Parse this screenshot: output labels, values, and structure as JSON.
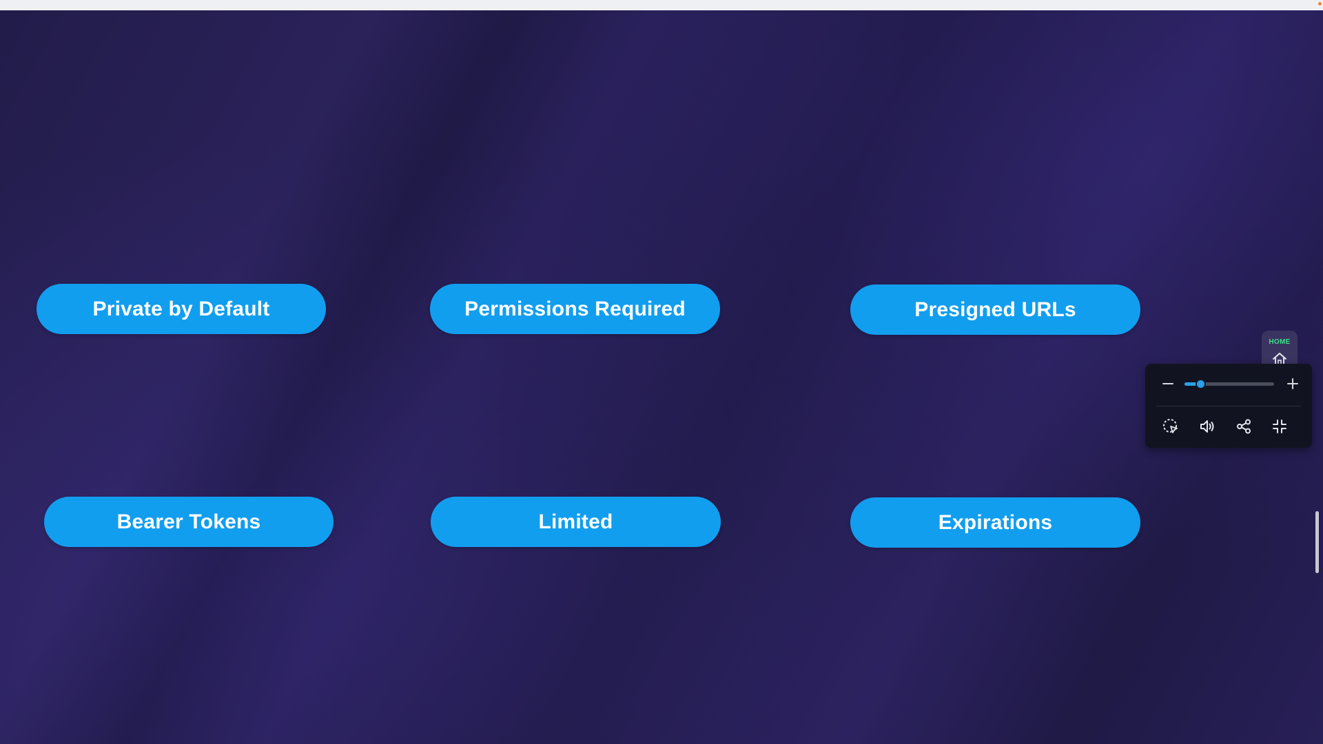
{
  "cards": [
    {
      "label": "Private by Default"
    },
    {
      "label": "Permissions Required"
    },
    {
      "label": "Presigned URLs"
    },
    {
      "label": "Bearer Tokens"
    },
    {
      "label": "Limited"
    },
    {
      "label": "Expirations"
    }
  ],
  "home": {
    "label": "HOME",
    "icon": "home-icon"
  },
  "zoom": {
    "level": 0.18
  },
  "toolbar": {
    "buttons": [
      {
        "name": "select",
        "icon": "select-pointer-icon"
      },
      {
        "name": "audio",
        "icon": "speaker-icon"
      },
      {
        "name": "share",
        "icon": "share-icon"
      },
      {
        "name": "exit-fullscreen",
        "icon": "exit-fullscreen-icon"
      }
    ]
  },
  "colors": {
    "background": "#221c4a",
    "pill": "#129eef",
    "pill_text": "#ffffff",
    "home_label": "#3fe08a",
    "zoom_accent": "#2aa0e6",
    "panel": "#111420"
  }
}
